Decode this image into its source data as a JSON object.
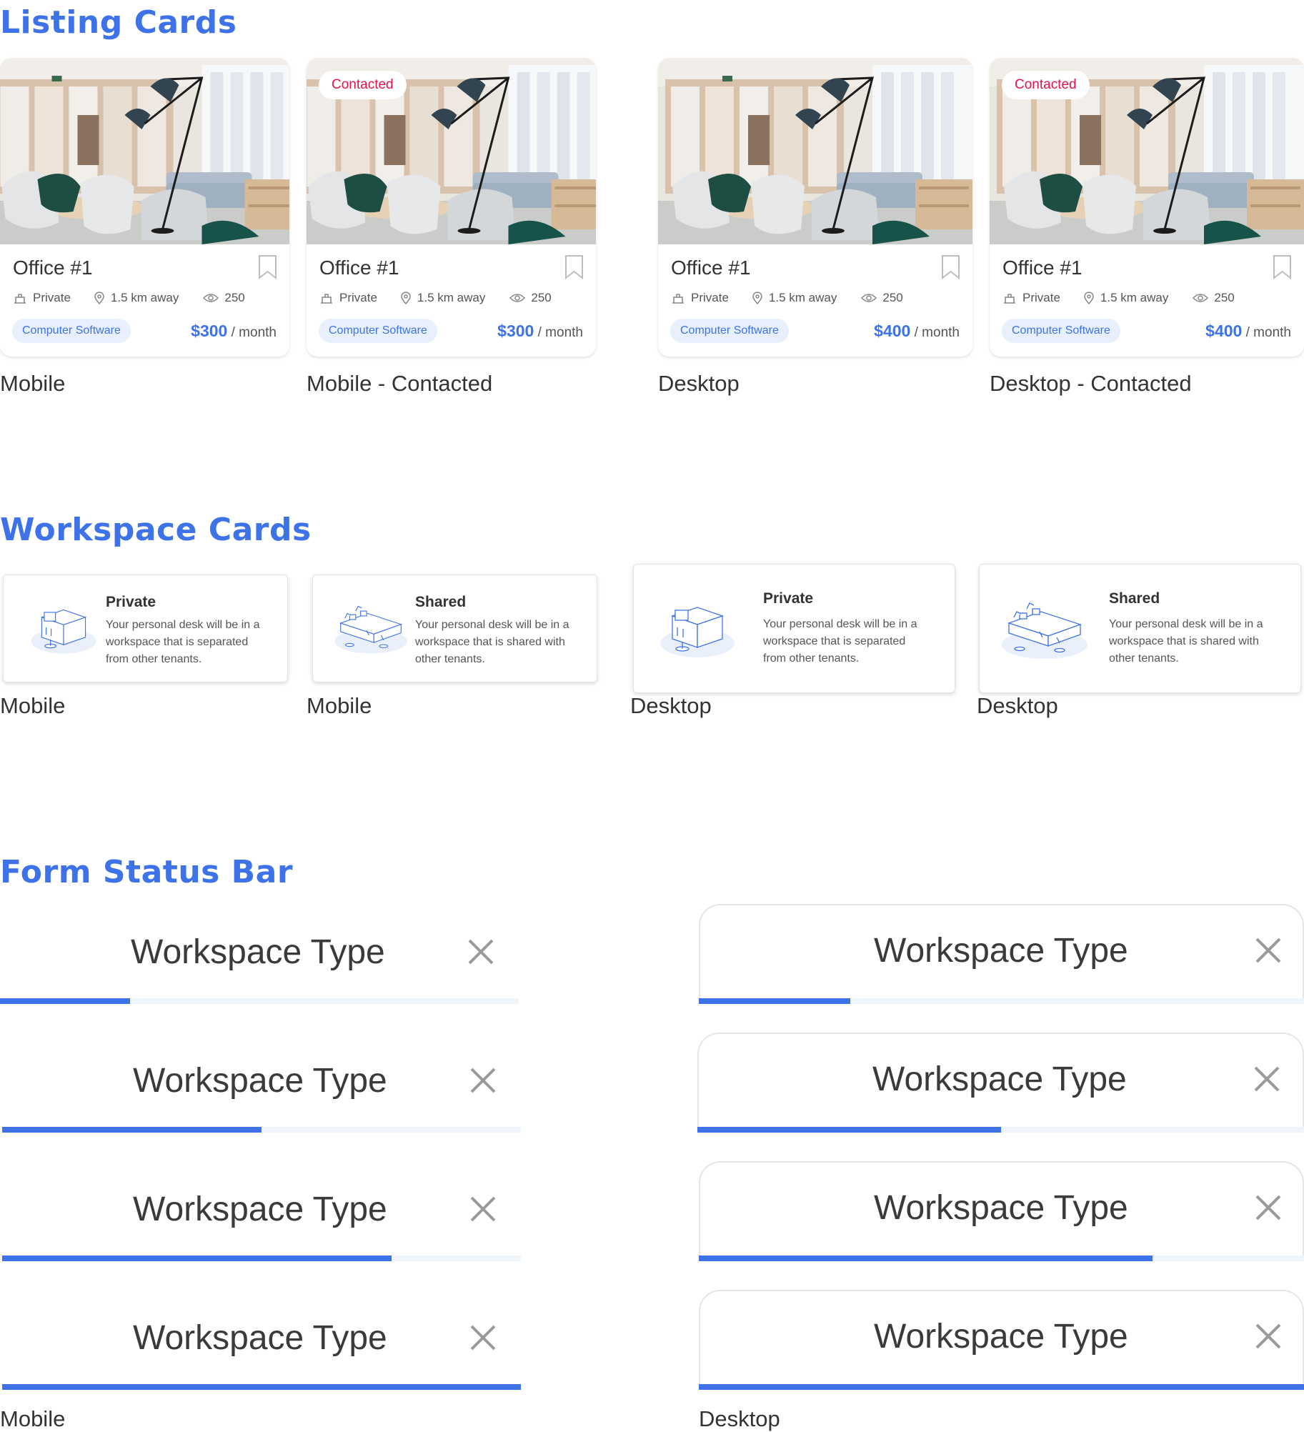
{
  "sections": {
    "listing": "Listing Cards",
    "workspace": "Workspace Cards",
    "status": "Form Status Bar"
  },
  "listing_cards": [
    {
      "badge": "",
      "title": "Office #1",
      "type": "Private",
      "distance": "1.5 km away",
      "views": "250",
      "category": "Computer Software",
      "price": "$300",
      "period": "/ month",
      "caption": "Mobile"
    },
    {
      "badge": "Contacted",
      "title": "Office #1",
      "type": "Private",
      "distance": "1.5 km away",
      "views": "250",
      "category": "Computer Software",
      "price": "$300",
      "period": "/ month",
      "caption": "Mobile - Contacted"
    },
    {
      "badge": "",
      "title": "Office #1",
      "type": "Private",
      "distance": "1.5 km away",
      "views": "250",
      "category": "Computer Software",
      "price": "$400",
      "period": "/ month",
      "caption": "Desktop"
    },
    {
      "badge": "Contacted",
      "title": "Office #1",
      "type": "Private",
      "distance": "1.5 km away",
      "views": "250",
      "category": "Computer Software",
      "price": "$400",
      "period": "/ month",
      "caption": "Desktop - Contacted"
    }
  ],
  "workspace_cards": [
    {
      "title": "Private",
      "line1": "Your personal desk will be in a",
      "line2": "workspace that is separated",
      "line3": "from other tenants.",
      "caption": "Mobile"
    },
    {
      "title": "Shared",
      "line1": "Your personal desk will be in a",
      "line2": "workspace that is shared with",
      "line3": "other tenants.",
      "caption": "Mobile"
    },
    {
      "title": "Private",
      "line1": "Your personal desk will be in a",
      "line2": "workspace that is separated",
      "line3": "from other tenants.",
      "caption": "Desktop"
    },
    {
      "title": "Shared",
      "line1": "Your personal desk will be in a",
      "line2": "workspace that is shared with",
      "line3": "other tenants.",
      "caption": "Desktop"
    }
  ],
  "status_bars": {
    "title": "Workspace Type",
    "mobile_progress": [
      0.25,
      0.5,
      0.75,
      1.0
    ],
    "desktop_progress": [
      0.25,
      0.5,
      0.75,
      1.0
    ],
    "mobile_caption": "Mobile",
    "desktop_caption": "Desktop"
  },
  "colors": {
    "accent": "#3d72e9",
    "badge": "#e0134a",
    "chip_bg": "#e8f0fe"
  },
  "icons": [
    "bookmark-icon",
    "building-icon",
    "location-pin-icon",
    "eye-icon",
    "close-icon",
    "desk-illustration-icon",
    "shared-desks-illustration-icon"
  ]
}
